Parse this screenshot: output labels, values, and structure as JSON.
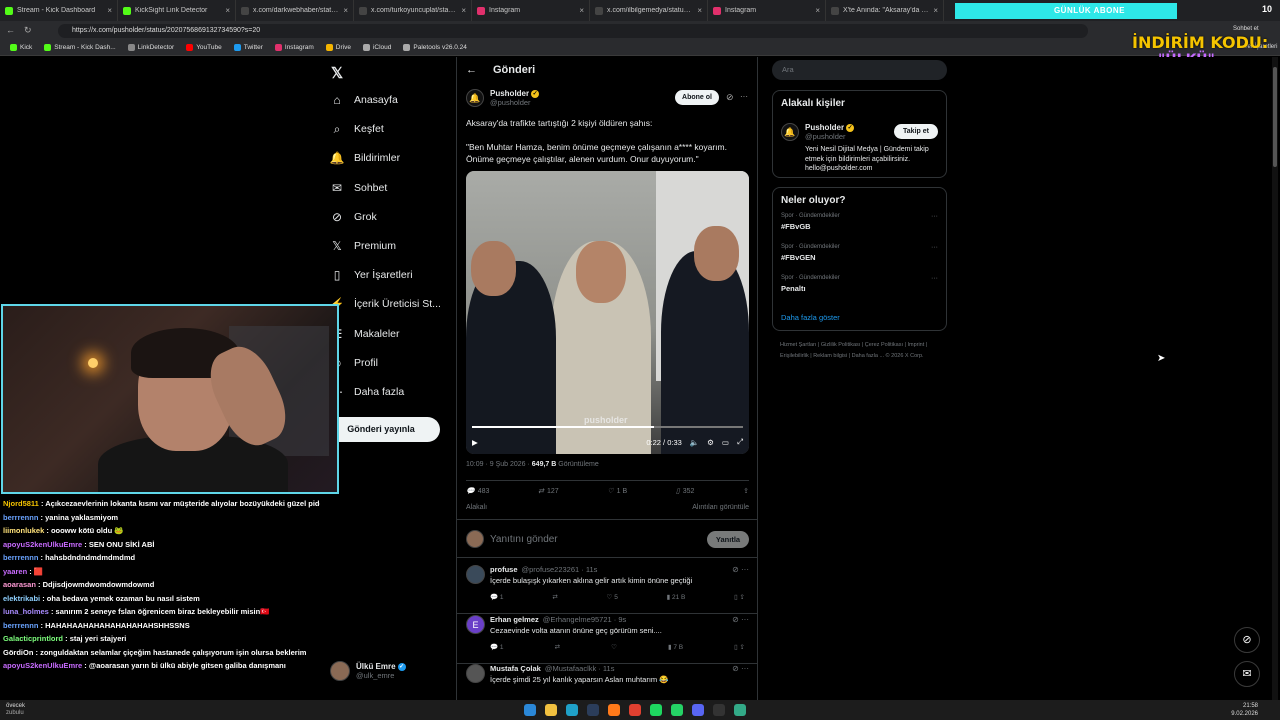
{
  "browser": {
    "tabs": [
      {
        "label": "Stream - Kick Dashboard",
        "color": "#53fc18"
      },
      {
        "label": "KickSight Link Detector",
        "color": "#53fc18"
      },
      {
        "label": "x.com/darkwebhaber/status/2020",
        "color": "#444"
      },
      {
        "label": "x.com/turkoyuncuplat/status/202",
        "color": "#444"
      },
      {
        "label": "Instagram",
        "color": "#e1306c"
      },
      {
        "label": "x.com/ilbilgemedya/status/2020",
        "color": "#444"
      },
      {
        "label": "Instagram",
        "color": "#e1306c"
      },
      {
        "label": "X'te Anında: \"Aksaray'da küçük y",
        "color": "#444"
      }
    ],
    "url": "https://x.com/pusholder/status/2020756869132734590?s=20",
    "bookmarks": [
      {
        "label": "Kick",
        "color": "#53fc18"
      },
      {
        "label": "Stream - Kick Dash...",
        "color": "#53fc18"
      },
      {
        "label": "LinkDetector",
        "color": "#888"
      },
      {
        "label": "YouTube",
        "color": "#ff0000"
      },
      {
        "label": "Twitter",
        "color": "#1d9bf0"
      },
      {
        "label": "Instagram",
        "color": "#e1306c"
      },
      {
        "label": "Drive",
        "color": "#f4b400"
      },
      {
        "label": "iCloud",
        "color": "#aaa"
      },
      {
        "label": "Paletools v26.0.24",
        "color": "#aaa"
      }
    ],
    "profile_label": "Sohbet et",
    "extra_label": "Yer İşaretleri",
    "tab_count": "10"
  },
  "overlay": {
    "banner": "GÜNLÜK ABONE",
    "code_title": "İNDİRİM KODU:",
    "code": "\"ÜLKÜ\""
  },
  "nav": {
    "items": [
      {
        "label": "Anasayfa",
        "icon": "home-icon",
        "glyph": "⌂"
      },
      {
        "label": "Keşfet",
        "icon": "search-icon",
        "glyph": "⌕"
      },
      {
        "label": "Bildirimler",
        "icon": "bell-icon",
        "glyph": "🔔"
      },
      {
        "label": "Sohbet",
        "icon": "chat-icon",
        "glyph": "✉"
      },
      {
        "label": "Grok",
        "icon": "grok-icon",
        "glyph": "⊘"
      },
      {
        "label": "Premium",
        "icon": "x-icon",
        "glyph": "𝕏"
      },
      {
        "label": "Yer İşaretleri",
        "icon": "bookmark-icon",
        "glyph": "▯"
      },
      {
        "label": "İçerik Üreticisi St...",
        "icon": "creator-icon",
        "glyph": "⚡"
      },
      {
        "label": "Makaleler",
        "icon": "articles-icon",
        "glyph": "☰"
      },
      {
        "label": "Profil",
        "icon": "profile-icon",
        "glyph": "☺"
      },
      {
        "label": "Daha fazla",
        "icon": "more-icon",
        "glyph": "⋯"
      }
    ],
    "post_button": "Gönderi yayınla",
    "account_name": "Ülkü Emre",
    "account_handle": "@ulk_emre"
  },
  "post": {
    "header": "Gönderi",
    "author": "Pusholder",
    "handle": "@pusholder",
    "subscribe": "Abone ol",
    "text": "Aksaray'da trafikte tartıştığı 2 kişiyi öldüren şahıs:\n\n\"Ben Muhtar Hamza, benim önüme geçmeye çalışanın a**** koyarım. Önüme geçmeye çalıştılar, alenen vurdum. Onur duyuyorum.\"",
    "video_time": "0:22 / 0:33",
    "video_watermark": "pusholder",
    "video_progress": 0.67,
    "time": "10:09 · 9 Şub 2026 ·",
    "views": "649,7 B",
    "views_label": "Görüntüleme",
    "replies": "483",
    "reposts": "127",
    "likes": "1 B",
    "bookmarks": "352",
    "related": "Alakalı",
    "related_views": "Alıntıları görüntüle",
    "reply_placeholder": "Yanıtını gönder",
    "reply_button": "Yanıtla"
  },
  "replies": [
    {
      "name": "profuse",
      "handle": "@profuse223261 · 11s",
      "text": "İçerde bulaşışk yıkarken aklına gelir artık kimin önüne geçtiği",
      "replies": "1",
      "reposts": "",
      "likes": "5",
      "views": "21 B",
      "avatar_color": "#3a4a5a",
      "avatar_letter": ""
    },
    {
      "name": "Erhan gelmez",
      "handle": "@Erhangelme95721 · 9s",
      "text": "Cezaevinde volta atanın önüne geç görürüm seni....",
      "replies": "1",
      "reposts": "",
      "likes": "",
      "views": "7 B",
      "avatar_color": "#6a3fc8",
      "avatar_letter": "E"
    },
    {
      "name": "Mustafa Çolak",
      "handle": "@Mustafaaclkk · 11s",
      "text": "İçerde şimdi 25 yıl kanlık yaparsın Aslan muhtarım 😂",
      "replies": "",
      "reposts": "",
      "likes": "",
      "views": "",
      "avatar_color": "#555",
      "avatar_letter": ""
    }
  ],
  "right": {
    "search_placeholder": "Ara",
    "related_title": "Alakalı kişiler",
    "rel_name": "Pusholder",
    "rel_handle": "@pusholder",
    "rel_follow": "Takip et",
    "rel_bio": "Yeni Nesil Dijital Medya | Gündemi takip etmek için bildirimleri açabilirsiniz. hello@pusholder.com",
    "trends_title": "Neler oluyor?",
    "trends": [
      {
        "cat": "Spor · Gündemdekiler",
        "tag": "#FBvGB"
      },
      {
        "cat": "Spor · Gündemdekiler",
        "tag": "#FBvGEN"
      },
      {
        "cat": "Spor · Gündemdekiler",
        "tag": "Penaltı"
      }
    ],
    "show_more": "Daha fazla göster",
    "footer": "Hizmet Şartları | Gizlilik Politikası | Çerez Politikası | Imprint | Erişilebilirlik | Reklam bilgisi | Daha fazla ... © 2026 X Corp."
  },
  "chat": [
    {
      "user": "Njord5811",
      "ucolor": "#f5c400",
      "msg": "Açıkcezaevlerinin lokanta kısmı var müşteride alıyolar bozüyükdeki güzel pide yapıyo"
    },
    {
      "user": "berrrennn",
      "ucolor": "#6aa3ff",
      "msg": "yanina yaklasmiyom"
    },
    {
      "user": "liimonlukek",
      "ucolor": "#ffe27a",
      "msg": "oooww kötü oldu 🐸"
    },
    {
      "user": "apoyuS2kenUlkuEmre",
      "ucolor": "#c86bff",
      "msg": "SEN ONU SİKİ ABİ"
    },
    {
      "user": "berrrennn",
      "ucolor": "#6aa3ff",
      "msg": "hahsbdndndmdmdmdmd"
    },
    {
      "user": "yaaren",
      "ucolor": "#c86bff",
      "msg": "🟥"
    },
    {
      "user": "aoarasan",
      "ucolor": "#ff9ad5",
      "msg": "Ddjisdjowmdwomdowmdowmd"
    },
    {
      "user": "elektrikabi",
      "ucolor": "#8fd0ff",
      "msg": "oha bedava yemek ozaman bu nasıl sistem"
    },
    {
      "user": "luna_holmes",
      "ucolor": "#a98bff",
      "msg": "sanırım 2 seneye fslan öğrenicem biraz bekleyebilir misin🇹🇷"
    },
    {
      "user": "berrrennn",
      "ucolor": "#6aa3ff",
      "msg": "HAHAHAAHAHAHAHAHAHAHSHHSSNS"
    },
    {
      "user": "Galacticprintlord",
      "ucolor": "#7dff7d",
      "msg": "staj yeri stajyeri"
    },
    {
      "user": "GördiOn",
      "ucolor": "#fff",
      "msg": "zonguldaktan selamlar çiçeğim hastanede çalışıyorum işin olursa beklerim"
    },
    {
      "user": "apoyuS2kenUlkuEmre",
      "ucolor": "#c86bff",
      "msg": "@aoarasan yarın bi ülkü abiyle gitsen galiba danışmanı"
    }
  ],
  "taskbar": {
    "time": "21:58",
    "date": "9.02.2026",
    "weather": "övecek",
    "weather_sub": "zubulu",
    "icons": [
      {
        "name": "windows-icon",
        "color": "#2b88d8"
      },
      {
        "name": "folder-icon",
        "color": "#f0c040"
      },
      {
        "name": "edge-icon",
        "color": "#1fa0c8"
      },
      {
        "name": "steam-icon",
        "color": "#2b3d5a"
      },
      {
        "name": "firefox-icon",
        "color": "#ff7a1a"
      },
      {
        "name": "chrome-icon",
        "color": "#e04030"
      },
      {
        "name": "spotify-icon",
        "color": "#1ed760"
      },
      {
        "name": "whatsapp-icon",
        "color": "#25d366"
      },
      {
        "name": "discord-icon",
        "color": "#5865f2"
      },
      {
        "name": "obs-icon",
        "color": "#333"
      },
      {
        "name": "app-icon",
        "color": "#3a8"
      }
    ]
  }
}
